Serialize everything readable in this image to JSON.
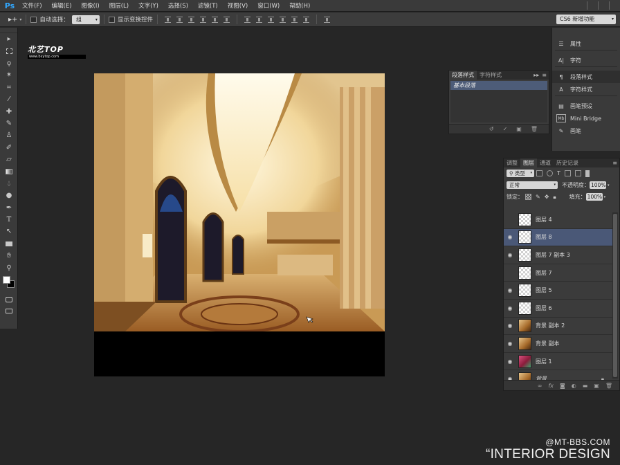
{
  "app": {
    "logo": "Ps"
  },
  "menu": [
    "文件(F)",
    "编辑(E)",
    "图像(I)",
    "图层(L)",
    "文字(Y)",
    "选择(S)",
    "滤镜(T)",
    "视图(V)",
    "窗口(W)",
    "帮助(H)"
  ],
  "options": {
    "auto_select_label": "自动选择：",
    "auto_select_value": "组",
    "show_transform_label": "显示变换控件",
    "workspace": "CS6 新增功能"
  },
  "watermark": {
    "logo": "北艺TOP",
    "url": "www.bxytop.com"
  },
  "paragraph_panel": {
    "tabs": [
      "段落样式",
      "字符样式"
    ],
    "active_tab": "段落样式",
    "item": "基本段落"
  },
  "dock": {
    "items": [
      {
        "label": "属性",
        "icon": "properties-icon"
      },
      {
        "label": "字符",
        "icon": "character-icon"
      },
      {
        "label": "段落样式",
        "icon": "paragraph-styles-icon"
      },
      {
        "label": "字符样式",
        "icon": "character-styles-icon"
      },
      {
        "label": "画笔预设",
        "icon": "brush-presets-icon"
      },
      {
        "label": "Mini Bridge",
        "icon": "mini-bridge-icon"
      },
      {
        "label": "画笔",
        "icon": "brush-icon"
      }
    ]
  },
  "layers_panel": {
    "tabs": [
      "调整",
      "图层",
      "通道",
      "历史记录"
    ],
    "active_tab": "图层",
    "filter_kind": "类型",
    "blend_mode": "正常",
    "opacity_label": "不透明度：",
    "opacity_value": "100%",
    "lock_label": "锁定：",
    "fill_label": "填充：",
    "fill_value": "100%",
    "layers": [
      {
        "name": "图层 4",
        "visible": false,
        "thumb": "trans",
        "selected": false
      },
      {
        "name": "图层 8",
        "visible": true,
        "thumb": "trans",
        "selected": true
      },
      {
        "name": "图层 7 副本 3",
        "visible": true,
        "thumb": "trans",
        "selected": false
      },
      {
        "name": "图层 7",
        "visible": false,
        "thumb": "trans",
        "selected": false
      },
      {
        "name": "图层 5",
        "visible": true,
        "thumb": "trans",
        "selected": false
      },
      {
        "name": "图层 6",
        "visible": true,
        "thumb": "trans",
        "selected": false
      },
      {
        "name": "背景 副本 2",
        "visible": true,
        "thumb": "photo",
        "selected": false
      },
      {
        "name": "背景 副本",
        "visible": true,
        "thumb": "photo",
        "selected": false
      },
      {
        "name": "图层 1",
        "visible": true,
        "thumb": "pink",
        "selected": false
      },
      {
        "name": "背景",
        "visible": true,
        "thumb": "photo",
        "selected": false,
        "locked": true
      }
    ]
  },
  "credit": {
    "site": "@MT-BBS.COM",
    "title": "“INTERIOR DESIGN"
  }
}
